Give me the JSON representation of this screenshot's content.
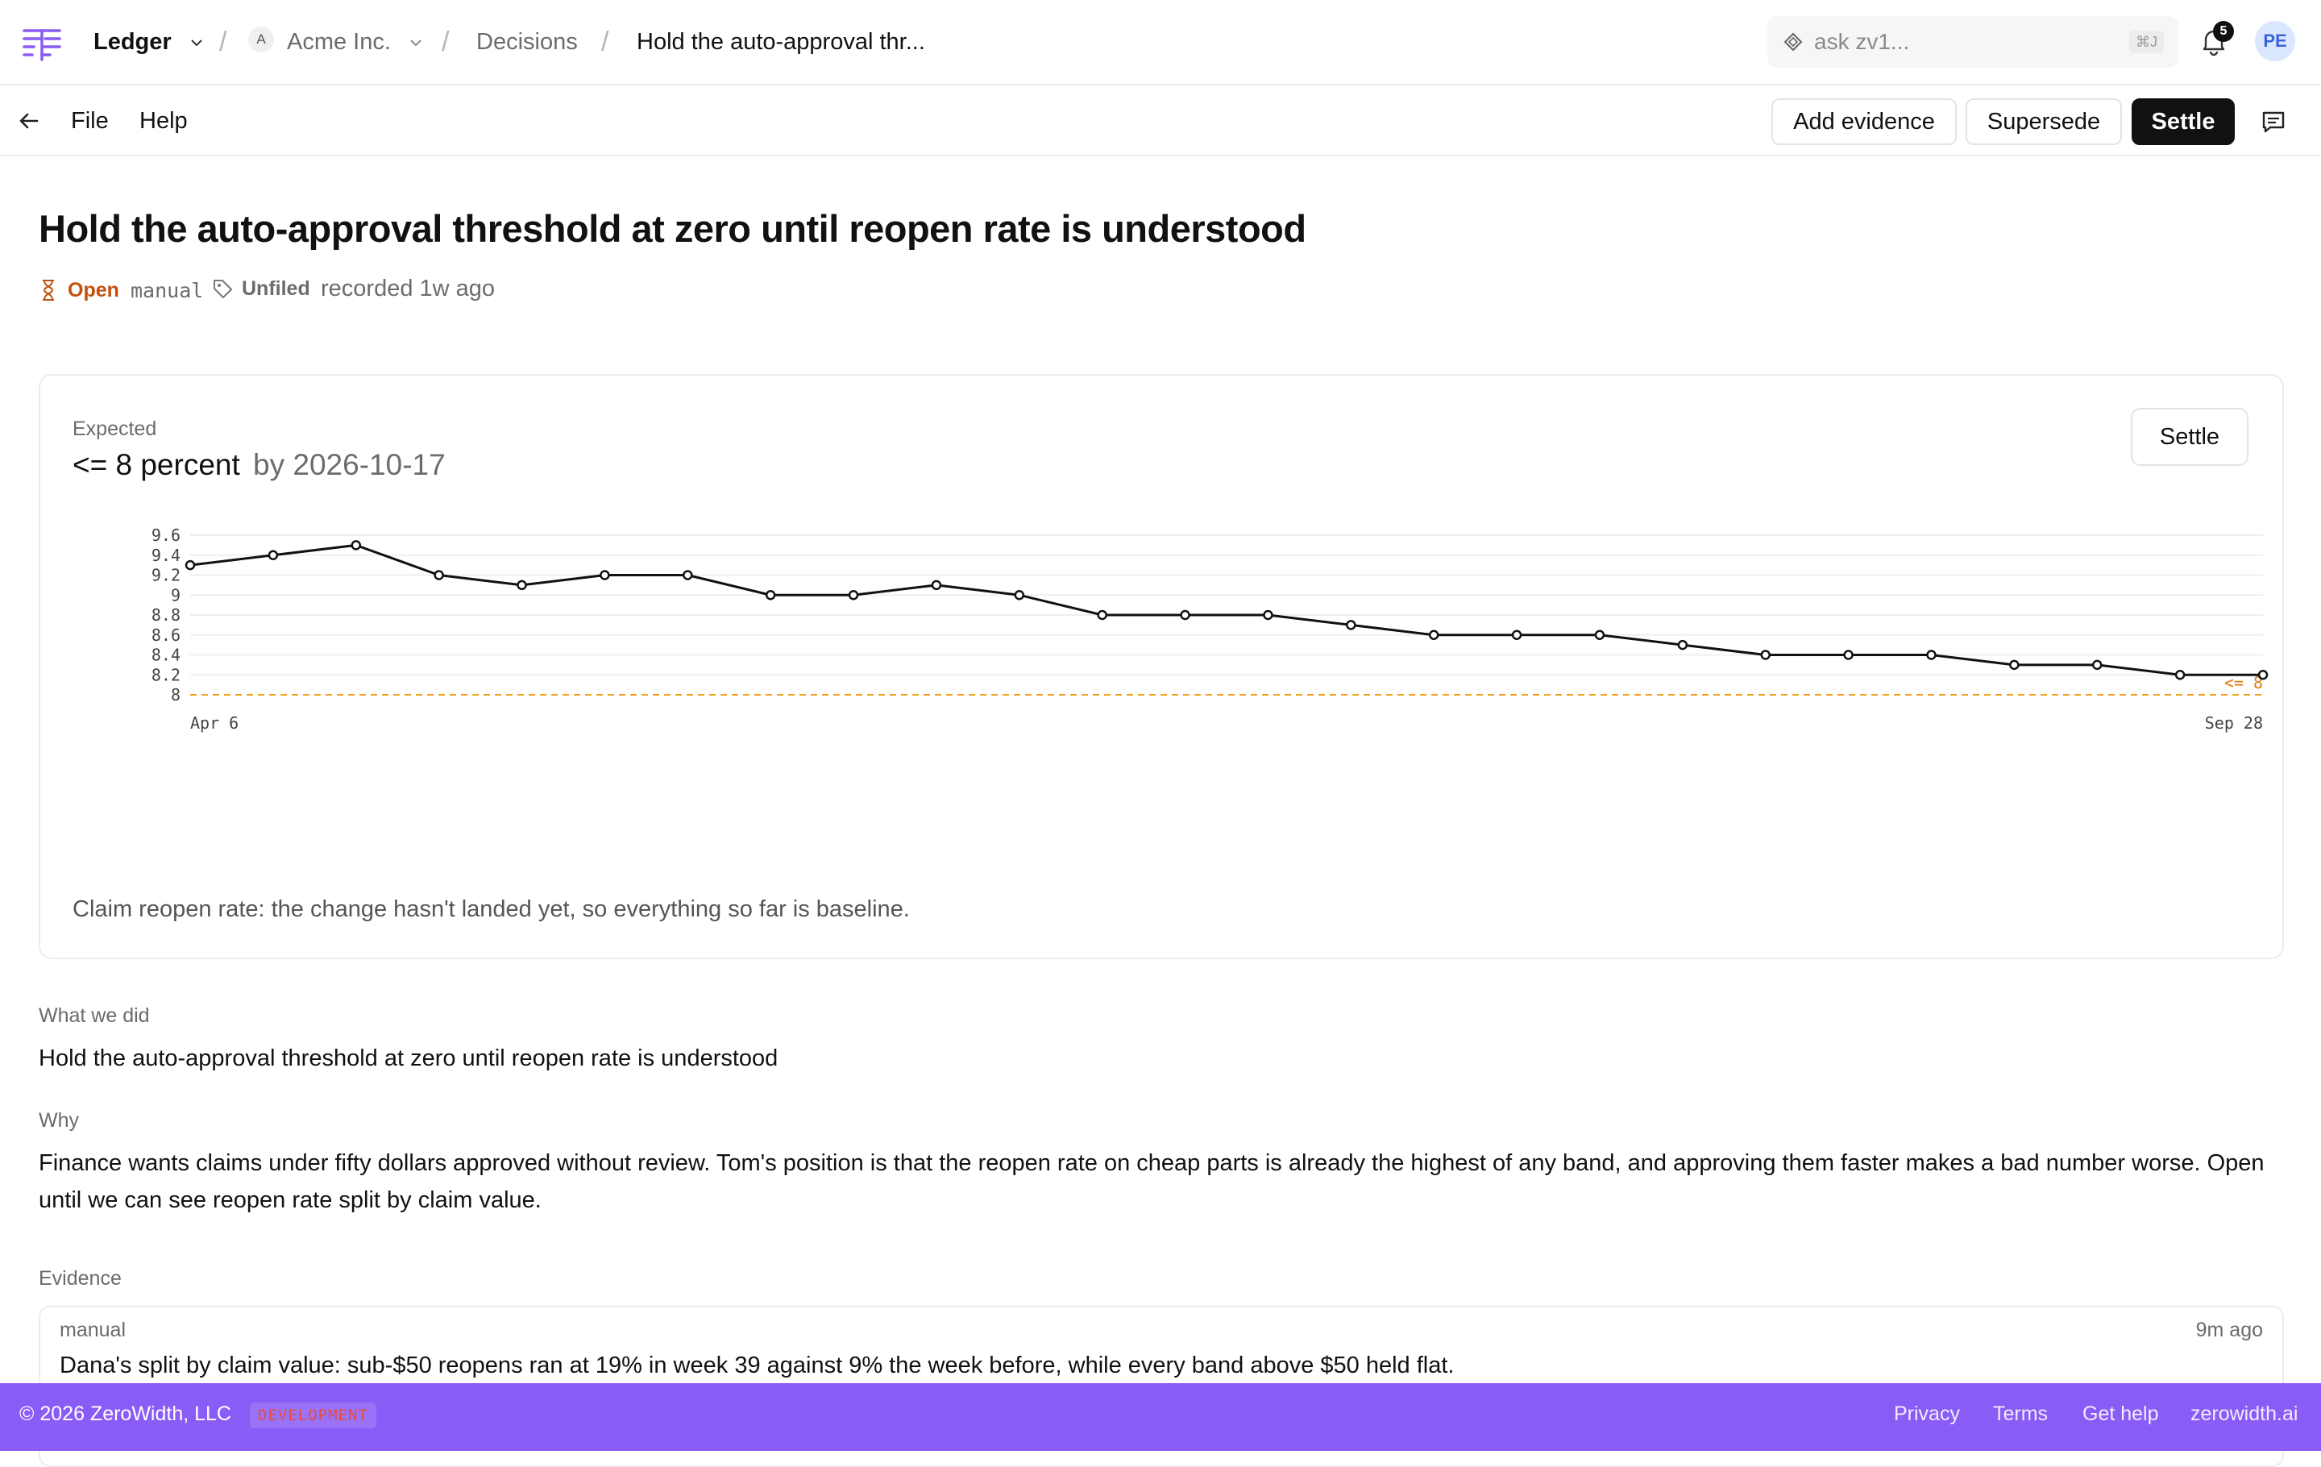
{
  "breadcrumb": {
    "app": "Ledger",
    "org_initial": "A",
    "org": "Acme Inc.",
    "section": "Decisions",
    "current": "Hold the auto-approval thr..."
  },
  "search": {
    "placeholder": "ask zv1...",
    "shortcut": "⌘J"
  },
  "notifications": {
    "count": "5"
  },
  "user": {
    "initials": "PE"
  },
  "toolbar": {
    "file": "File",
    "help": "Help",
    "add_evidence": "Add evidence",
    "supersede": "Supersede",
    "settle": "Settle"
  },
  "decision": {
    "title": "Hold the auto-approval threshold at zero until reopen rate is understood",
    "status": "Open",
    "source": "manual",
    "tag": "Unfiled",
    "recorded": "recorded 1w ago"
  },
  "expected": {
    "label": "Expected",
    "target": "<= 8 percent",
    "by": "by 2026-10-17",
    "settle": "Settle",
    "caption": "Claim reopen rate: the change hasn't landed yet, so everything so far is baseline."
  },
  "chart_data": {
    "type": "line",
    "title": "",
    "xlabel": "",
    "ylabel": "",
    "ylim": [
      8,
      9.6
    ],
    "yticks": [
      "9.6",
      "9.4",
      "9.2",
      "9",
      "8.8",
      "8.6",
      "8.4",
      "8.2",
      "8"
    ],
    "xtick_first": "Apr 6",
    "xtick_last": "Sep 28",
    "threshold": {
      "value": 8,
      "label": "<= 8",
      "color": "#f0a020"
    },
    "grid": true,
    "series": [
      {
        "color": "#111111",
        "values": [
          9.3,
          9.4,
          9.5,
          9.2,
          9.1,
          9.2,
          9.2,
          9.0,
          9.0,
          9.1,
          9.0,
          8.8,
          8.8,
          8.8,
          8.7,
          8.6,
          8.6,
          8.6,
          8.5,
          8.4,
          8.4,
          8.4,
          8.3,
          8.3,
          8.2,
          8.2
        ]
      }
    ]
  },
  "what_we_did": {
    "label": "What we did",
    "text": "Hold the auto-approval threshold at zero until reopen rate is understood"
  },
  "why": {
    "label": "Why",
    "text": "Finance wants claims under fifty dollars approved without review. Tom's position is that the reopen rate on cheap parts is already the highest of any band, and approving them faster makes a bad number worse. Open until we can see reopen rate split by claim value."
  },
  "evidence": {
    "label": "Evidence",
    "items": [
      {
        "source": "manual",
        "time": "9m ago",
        "text": "Dana's split by claim value: sub-$50 reopens ran at 19% in week 39 against 9% the week before, while every band above $50 held flat."
      }
    ]
  },
  "footer": {
    "copyright": "© 2026 ZeroWidth, LLC",
    "env": "DEVELOPMENT",
    "privacy": "Privacy",
    "terms": "Terms",
    "help": "Get help",
    "site": "zerowidth.ai"
  }
}
